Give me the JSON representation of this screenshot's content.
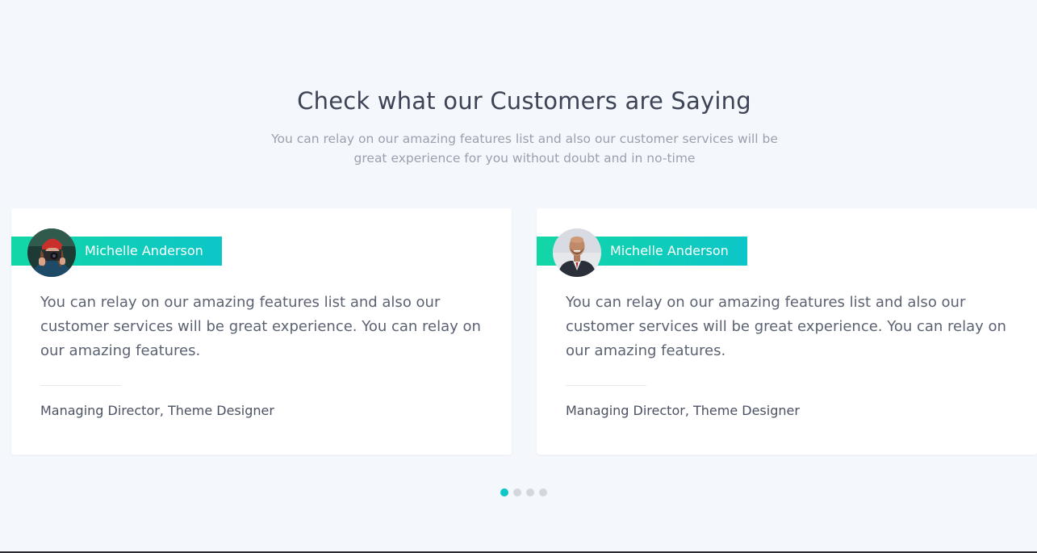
{
  "section": {
    "title": "Check what our Customers are Saying",
    "subtitle": "You can relay on our amazing features list and also our customer services will be great experience for you without doubt and in no-time"
  },
  "testimonials": [
    {
      "name": "Michelle Anderson",
      "avatar": "woman-with-camera-red-beanie-photo",
      "quote": "You can relay on our amazing features list and also our customer services will be great experience. You can relay on our amazing features.",
      "role": "Managing Director, Theme Designer"
    },
    {
      "name": "Michelle Anderson",
      "avatar": "bald-man-in-suit-photo",
      "quote": "You can relay on our amazing features list and also our customer services will be great experience. You can relay on our amazing features.",
      "role": "Managing Director, Theme Designer"
    }
  ],
  "carousel": {
    "dot_count": 4,
    "active_index": 0
  },
  "colors": {
    "accent_start": "#12d6a6",
    "accent_end": "#0cc6c8",
    "background": "#f4f7fb",
    "heading": "#3c4456",
    "muted_text": "#9aa0ae"
  }
}
